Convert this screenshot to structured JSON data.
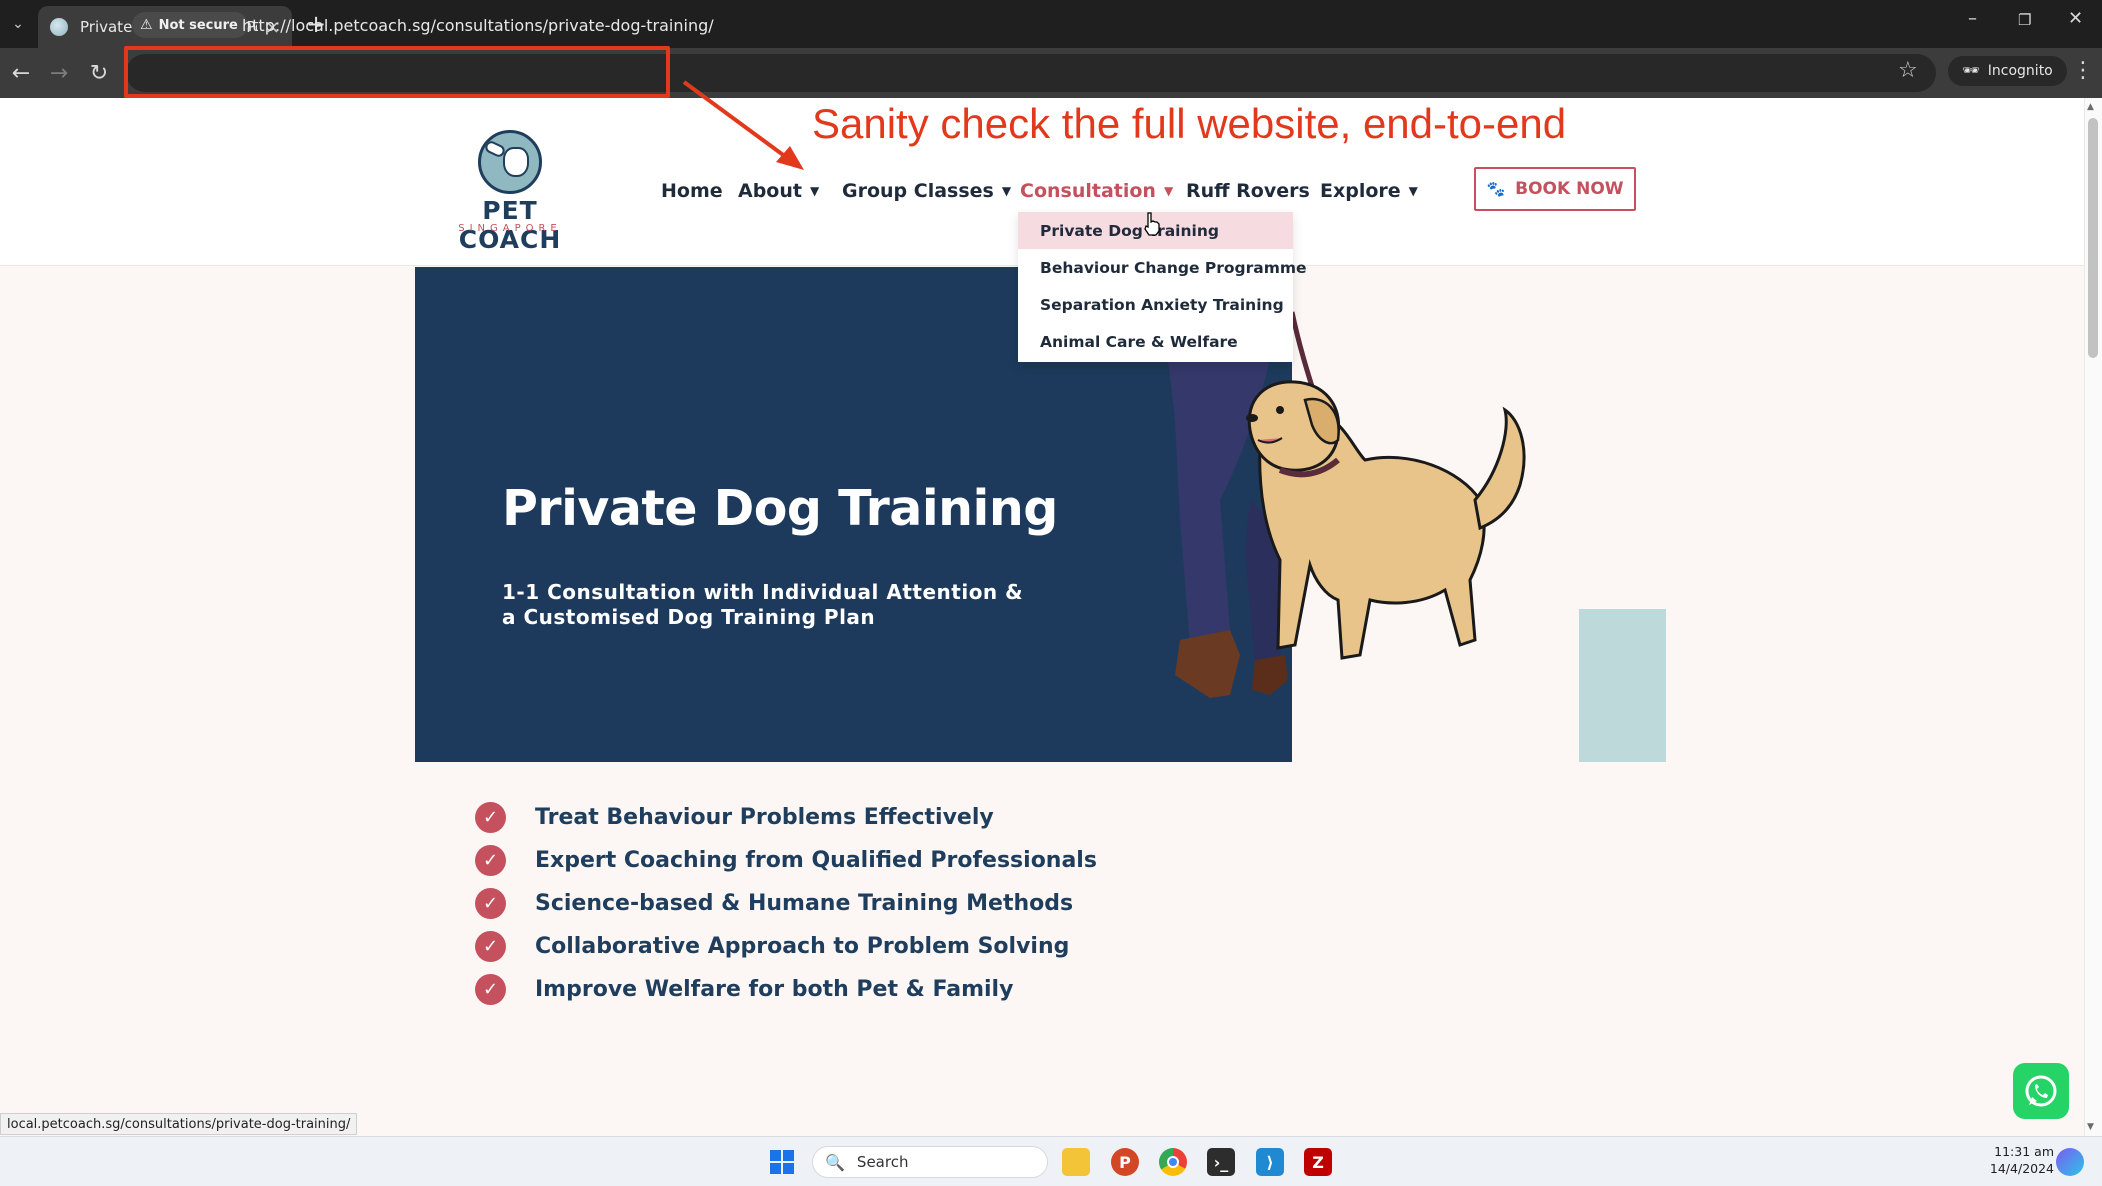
{
  "browser": {
    "tab_title": "Private Dog Training - Pet Coac",
    "security_label": "Not secure",
    "url": "http://local.petcoach.sg/consultations/private-dog-training/",
    "profile_label": "Incognito",
    "status_url": "local.petcoach.sg/consultations/private-dog-training/"
  },
  "annotation": {
    "text": "Sanity check the full website, end-to-end",
    "color": "#e2391c"
  },
  "logo": {
    "title": "PET COACH",
    "subtitle": "SINGAPORE"
  },
  "nav": {
    "items": [
      {
        "label": "Home",
        "has_caret": false
      },
      {
        "label": "About",
        "has_caret": true
      },
      {
        "label": "Group Classes",
        "has_caret": true
      },
      {
        "label": "Consultation",
        "has_caret": true,
        "active": true
      },
      {
        "label": "Ruff Rovers",
        "has_caret": false
      },
      {
        "label": "Explore",
        "has_caret": true
      }
    ],
    "book_button": "BOOK NOW"
  },
  "dropdown": {
    "items": [
      {
        "label": "Private Dog Training",
        "hovered": true
      },
      {
        "label": "Behaviour Change Programme"
      },
      {
        "label": "Separation Anxiety Training"
      },
      {
        "label": "Animal Care & Welfare"
      }
    ]
  },
  "hero": {
    "title": "Private Dog Training",
    "subtitle_line1": "1-1 Consultation with Individual Attention &",
    "subtitle_line2": "a Customised Dog Training Plan"
  },
  "features": [
    "Treat Behaviour Problems Effectively",
    "Expert Coaching from Qualified Professionals",
    "Science-based & Humane Training Methods",
    "Collaborative Approach to Problem Solving",
    "Improve Welfare for both Pet & Family"
  ],
  "taskbar": {
    "search_placeholder": "Search",
    "time": "11:31 am",
    "date": "14/4/2024"
  },
  "colors": {
    "brand_navy": "#1d3a5c",
    "brand_rose": "#c4515d",
    "teal_accent": "#bdd9da",
    "page_bg": "#fcf7f4"
  }
}
